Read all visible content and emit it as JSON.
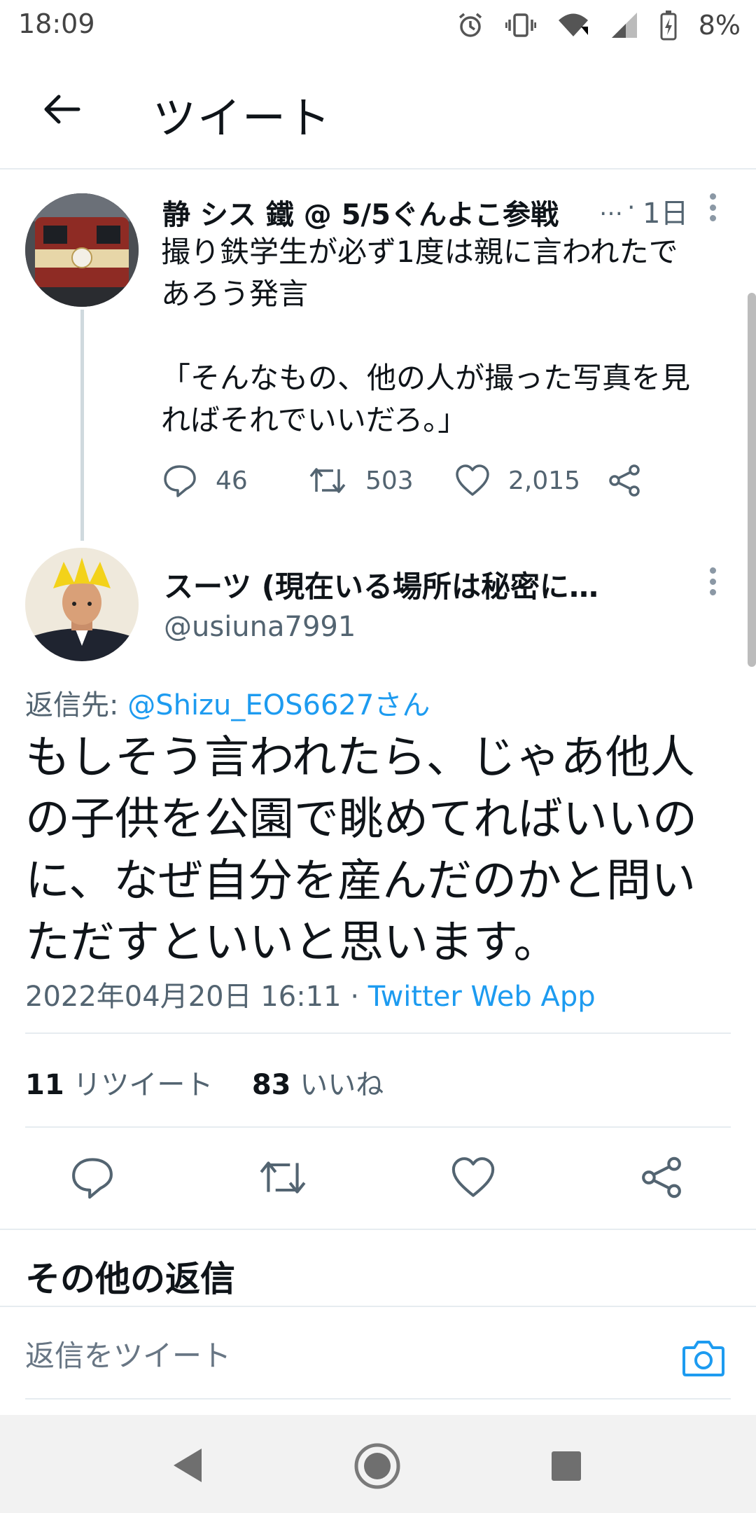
{
  "status_bar": {
    "time": "18:09",
    "battery": "8%",
    "icons": [
      "alarm-icon",
      "vibrate-icon",
      "wifi-icon",
      "signal-icon",
      "battery-charging-icon"
    ]
  },
  "header": {
    "title": "ツイート"
  },
  "parent_tweet": {
    "display_name": "静 シス 鐵 @ 5/5ぐんよこ参戦",
    "ellipsis": "…",
    "time_sep": "·",
    "time": "1日",
    "text": "撮り鉄学生が必ず1度は親に言われたで\nあろう発言\n\n「そんなもの、他の人が撮った写真を見\nればそれでいいだろ。」",
    "reply_count": "46",
    "retweet_count": "503",
    "like_count": "2,015"
  },
  "main_tweet": {
    "display_name": "スーツ (現在いる場所は秘密に…",
    "handle": "@usiuna7991",
    "reply_to_label": "返信先:",
    "reply_to_handle": "@Shizu_EOS6627さん",
    "text": "もしそう言われたら、じゃあ他人\nの子供を公園で眺めてればいいの\nに、なぜ自分を産んだのかと問い\nただすといいと思います。",
    "timestamp": "2022年04月20日 16:11",
    "sep": "·",
    "source": "Twitter Web App",
    "retweets_count": "11",
    "retweets_label": "リツイート",
    "likes_count": "83",
    "likes_label": "いいね"
  },
  "more_replies": {
    "heading": "その他の返信"
  },
  "composer": {
    "placeholder": "返信をツイート"
  },
  "colors": {
    "accent": "#1d9bf0",
    "text": "#0f1419",
    "muted": "#536471",
    "divider": "#e6ecf0"
  }
}
